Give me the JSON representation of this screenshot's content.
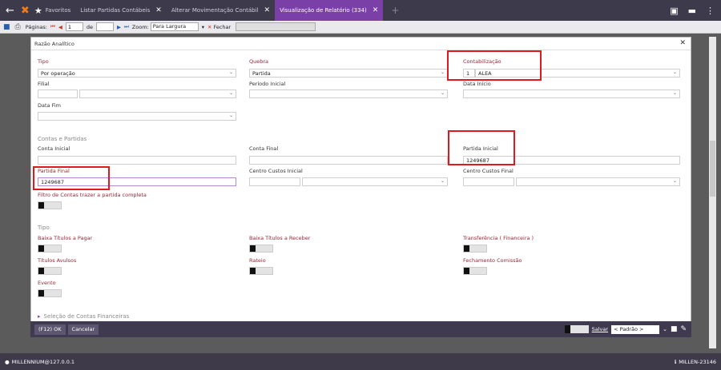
{
  "tabs": [
    {
      "label": "Favoritos"
    },
    {
      "label": "Listar Partidas Contábeis"
    },
    {
      "label": "Alterar Movimentação Contábil"
    },
    {
      "label": "Visualização de Relatório (334)"
    }
  ],
  "toolbar": {
    "pages_label": "Páginas:",
    "page_value": "1",
    "of_label": "de",
    "zoom_label": "Zoom:",
    "zoom_value": "Para Largura",
    "close_label": "Fechar"
  },
  "panel": {
    "title": "Razão Analítico"
  },
  "fields": {
    "tipo_label": "Tipo",
    "tipo_value": "Por operação",
    "quebra_label": "Quebra",
    "quebra_value": "Partida",
    "contab_label": "Contabilização",
    "contab_code": "1",
    "contab_value": "ALEA",
    "filial_label": "Filial",
    "periodo_label": "Período Inicial",
    "data_inicio_label": "Data Início",
    "data_fim_label": "Data Fim",
    "contas_section": "Contas e Partidas",
    "conta_inicial_label": "Conta Inicial",
    "conta_final_label": "Conta Final",
    "partida_inicial_label": "Partida Inicial",
    "partida_inicial_value": "1249687",
    "partida_final_label": "Partida Final",
    "partida_final_value": "1249687",
    "cc_inicial_label": "Centro Custos Inicial",
    "cc_final_label": "Centro Custos Final",
    "filtro_label": "Filtro de Contas trazer a partida completa",
    "tipo_section": "Tipo",
    "baixa_pagar": "Baixa Títulos a Pagar",
    "baixa_receber": "Baixa Títulos a Receber",
    "transferencia": "Transferência ( Financeira )",
    "titulos_avulsos": "Títulos Avulsos",
    "rateio": "Rateio",
    "fechamento": "Fechamento Comissão",
    "evento": "Evento",
    "selecao": "Seleção de Contas Financeiras"
  },
  "footer": {
    "ok_label": "(F12) OK",
    "cancel_label": "Cancelar",
    "save_label": "Salvar",
    "preset_value": "< Padrão >"
  },
  "status": {
    "left": "MILLENNIUM@127.0.0.1",
    "right": "MILLEN-23146"
  }
}
